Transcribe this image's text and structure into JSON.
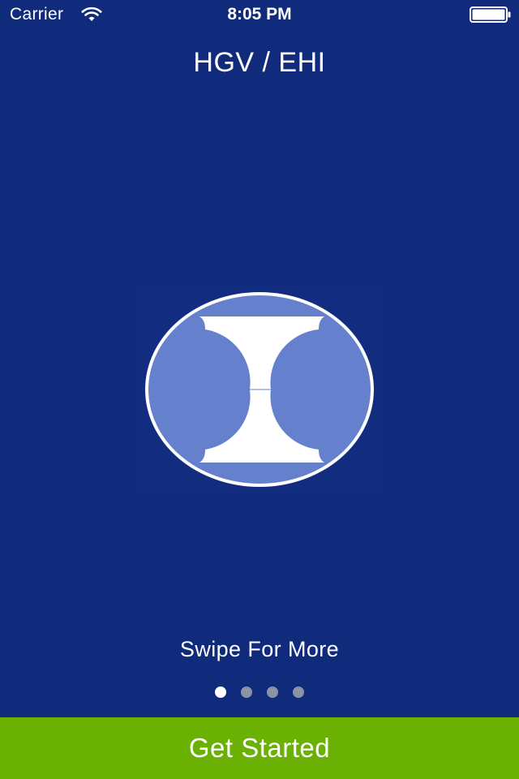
{
  "status_bar": {
    "carrier": "Carrier",
    "time": "8:05 PM",
    "wifi_icon": "wifi-icon",
    "battery_icon": "battery-icon"
  },
  "header": {
    "title": "HGV / EHI"
  },
  "onboarding": {
    "logo_icon": "hgv-ehi-logo",
    "swipe_hint": "Swipe For More",
    "pages_total": 4,
    "current_page": 1
  },
  "footer": {
    "get_started_label": "Get Started"
  },
  "colors": {
    "background": "#112b7c",
    "logo_fill": "#6580cc",
    "button": "#6ab104",
    "dot_active": "#ffffff",
    "dot_inactive": "#8b93a6"
  }
}
